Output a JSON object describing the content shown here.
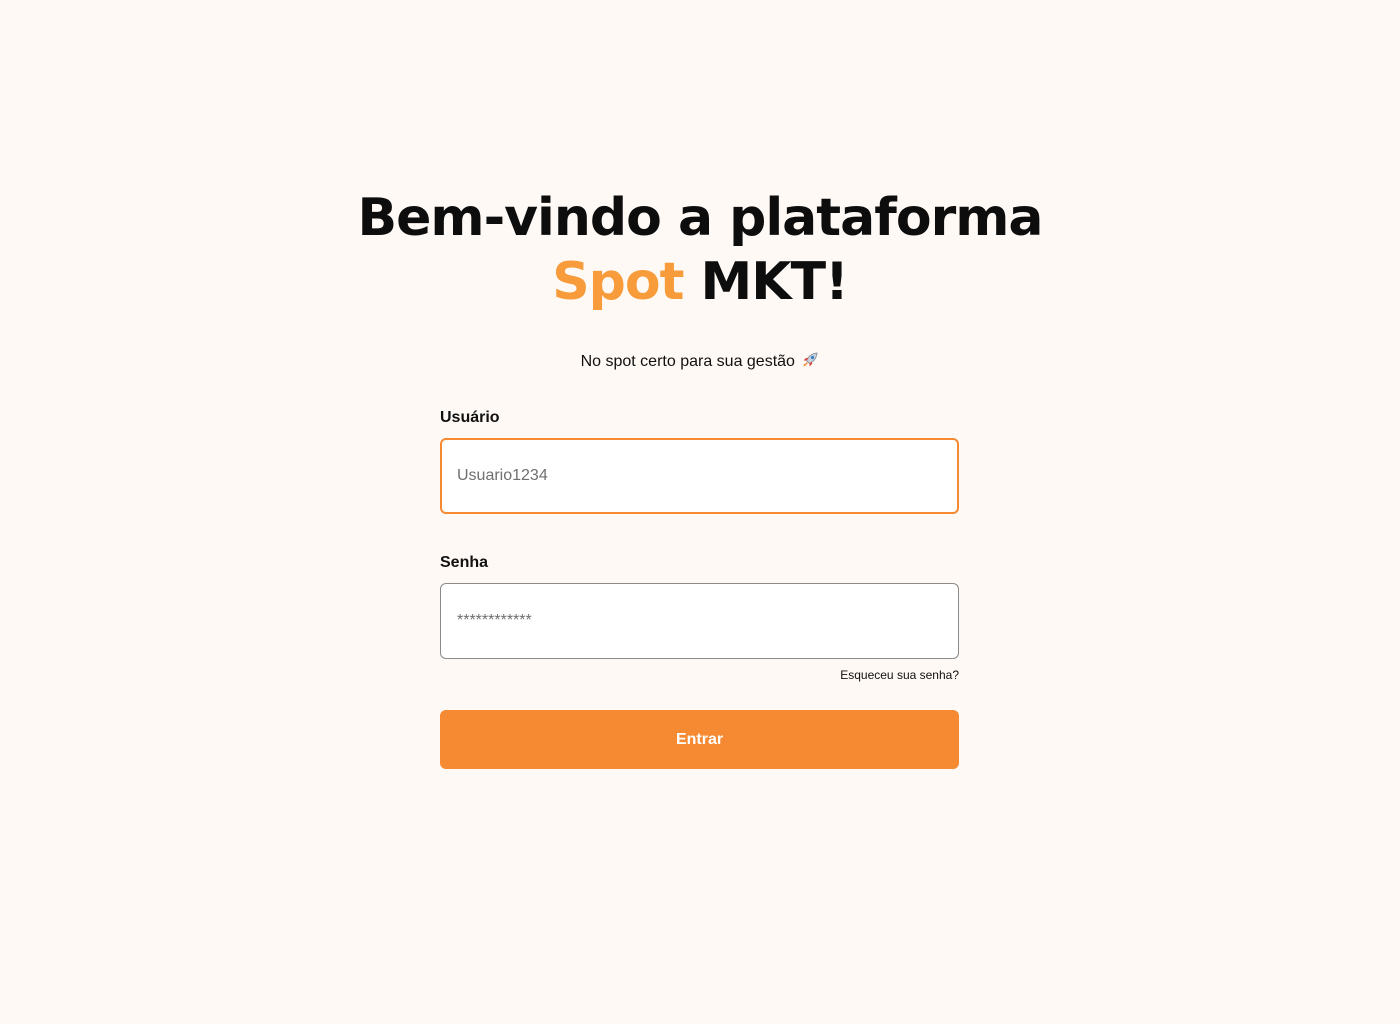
{
  "hero": {
    "title_line1": "Bem-vindo a plataforma",
    "brand_accent": "Spot",
    "brand_rest": " MKT!",
    "subtitle": "No spot certo para sua gestão",
    "subtitle_icon": "rocket-icon"
  },
  "form": {
    "username": {
      "label": "Usuário",
      "placeholder": "Usuario1234",
      "value": ""
    },
    "password": {
      "label": "Senha",
      "placeholder": "************",
      "value": ""
    },
    "forgot_password": "Esqueceu sua senha?",
    "submit_label": "Entrar"
  },
  "colors": {
    "background": "#FEF9F5",
    "accent": "#F58A33",
    "brand_text": "#F79B3B",
    "text": "#111111"
  }
}
